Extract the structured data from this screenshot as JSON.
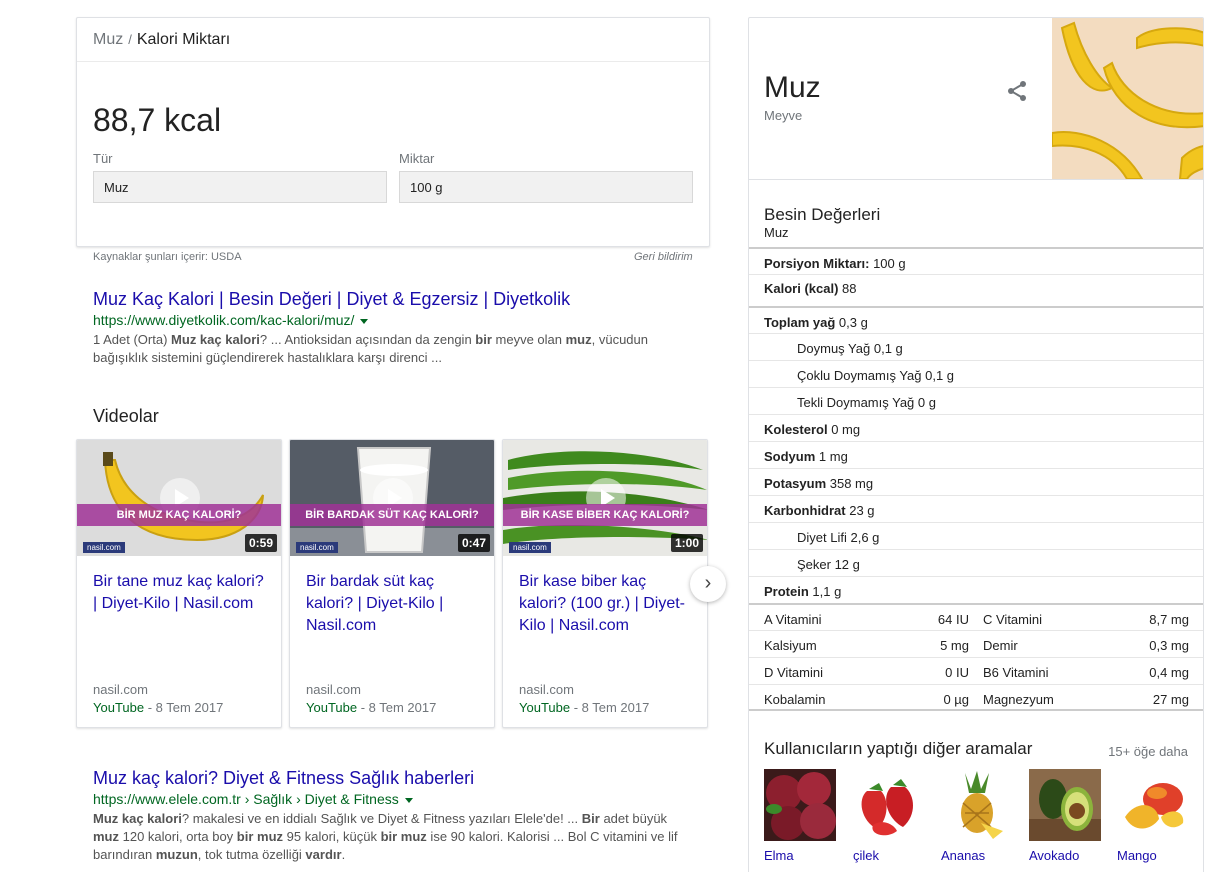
{
  "calorie_card": {
    "breadcrumb_1": "Muz",
    "breadcrumb_sep": "/",
    "breadcrumb_2": "Kalori Miktarı",
    "value": "88,7 kcal",
    "type_label": "Tür",
    "type_value": "Muz",
    "amount_label": "Miktar",
    "amount_value": "100 g",
    "sources": "Kaynaklar şunları içerir: USDA",
    "feedback": "Geri bildirim"
  },
  "results": [
    {
      "title": "Muz Kaç Kalori | Besin Değeri | Diyet & Egzersiz | Diyetkolik",
      "url": "https://www.diyetkolik.com/kac-kalori/muz/",
      "snippet_html": "1 Adet (Orta) <b>Muz kaç kalori</b>? ... Antioksidan açısından da zengin <b>bir</b> meyve olan <b>muz</b>, vücudun bağışıklık sistemini güçlendirerek hastalıklara karşı direnci ..."
    },
    {
      "title": "Muz kaç kalori? Diyet & Fitness Sağlık haberleri",
      "url": "https://www.elele.com.tr › Sağlık › Diyet & Fitness",
      "snippet_html": "<b>Muz kaç kalori</b>? makalesi ve en iddialı Sağlık ve Diyet &amp; Fitness yazıları Elele'de! ... <b>Bir</b> adet büyük <b>muz</b> 120 kalori, orta boy <b>bir muz</b> 95 kalori, küçük <b>bir muz</b> ise 90 kalori. Kalorisi ... Bol C vitamini ve lif barındıran <b>muzun</b>, tok tutma özelliği <b>vardır</b>."
    }
  ],
  "videos": {
    "heading": "Videolar",
    "items": [
      {
        "band": "BİR MUZ KAÇ KALORİ?",
        "logo": "nasil.com",
        "duration": "0:59",
        "title": "Bir tane muz kaç kalori? | Diyet-Kilo | Nasil.com",
        "source": "nasil.com",
        "platform": "YouTube",
        "date": " - 8 Tem 2017"
      },
      {
        "band": "BİR BARDAK SÜT KAÇ KALORİ?",
        "logo": "nasil.com",
        "duration": "0:47",
        "title": "Bir bardak süt kaç kalori? | Diyet-Kilo | Nasil.com",
        "source": "nasil.com",
        "platform": "YouTube",
        "date": " - 8 Tem 2017"
      },
      {
        "band": "BİR KASE BİBER KAÇ KALORİ?",
        "logo": "nasil.com",
        "duration": "1:00",
        "title": "Bir kase biber kaç kalori? (100 gr.) | Diyet-Kilo | Nasil.com",
        "source": "nasil.com",
        "platform": "YouTube",
        "date": " - 8 Tem 2017"
      }
    ],
    "next_icon": "chevron-right-icon"
  },
  "knowledge_panel": {
    "title": "Muz",
    "subtitle": "Meyve",
    "share_icon": "share-icon",
    "nutrition_heading": "Besin Değerleri",
    "nutrition_sub": "Muz",
    "rows": [
      {
        "label": "Porsiyon Miktarı:",
        "value": " 100 g",
        "bold": true,
        "indent": false
      },
      {
        "label": "Kalori (kcal)",
        "value": " 88",
        "bold": true,
        "indent": false
      },
      {
        "label": "Toplam yağ",
        "value": " 0,3 g",
        "bold": true,
        "indent": false
      },
      {
        "label": "Doymuş Yağ",
        "value": " 0,1 g",
        "bold": false,
        "indent": true
      },
      {
        "label": "Çoklu Doymamış Yağ",
        "value": " 0,1 g",
        "bold": false,
        "indent": true
      },
      {
        "label": "Tekli Doymamış Yağ",
        "value": " 0 g",
        "bold": false,
        "indent": true
      },
      {
        "label": "Kolesterol",
        "value": " 0 mg",
        "bold": true,
        "indent": false
      },
      {
        "label": "Sodyum",
        "value": " 1 mg",
        "bold": true,
        "indent": false
      },
      {
        "label": "Potasyum",
        "value": " 358 mg",
        "bold": true,
        "indent": false
      },
      {
        "label": "Karbonhidrat",
        "value": " 23 g",
        "bold": true,
        "indent": false
      },
      {
        "label": "Diyet Lifi",
        "value": " 2,6 g",
        "bold": false,
        "indent": true
      },
      {
        "label": "Şeker",
        "value": " 12 g",
        "bold": false,
        "indent": true
      },
      {
        "label": "Protein",
        "value": " 1,1 g",
        "bold": true,
        "indent": false
      }
    ],
    "vitamins": [
      {
        "n1": "A Vitamini",
        "v1": "64 IU",
        "n2": "C Vitamini",
        "v2": "8,7 mg"
      },
      {
        "n1": "Kalsiyum",
        "v1": "5 mg",
        "n2": "Demir",
        "v2": "0,3 mg"
      },
      {
        "n1": "D Vitamini",
        "v1": "0 IU",
        "n2": "B6 Vitamini",
        "v2": "0,4 mg"
      },
      {
        "n1": "Kobalamin",
        "v1": "0 µg",
        "n2": "Magnezyum",
        "v2": "27 mg"
      }
    ],
    "also_heading": "Kullanıcıların yaptığı diğer aramalar",
    "also_more": "15+ öğe daha",
    "also_items": [
      "Elma",
      "çilek",
      "Ananas",
      "Avokado",
      "Mango"
    ]
  },
  "colors": {
    "link": "#1a0dab",
    "url": "#006621",
    "snippet": "#545454",
    "muted": "#70757a",
    "band": "#a03296"
  }
}
